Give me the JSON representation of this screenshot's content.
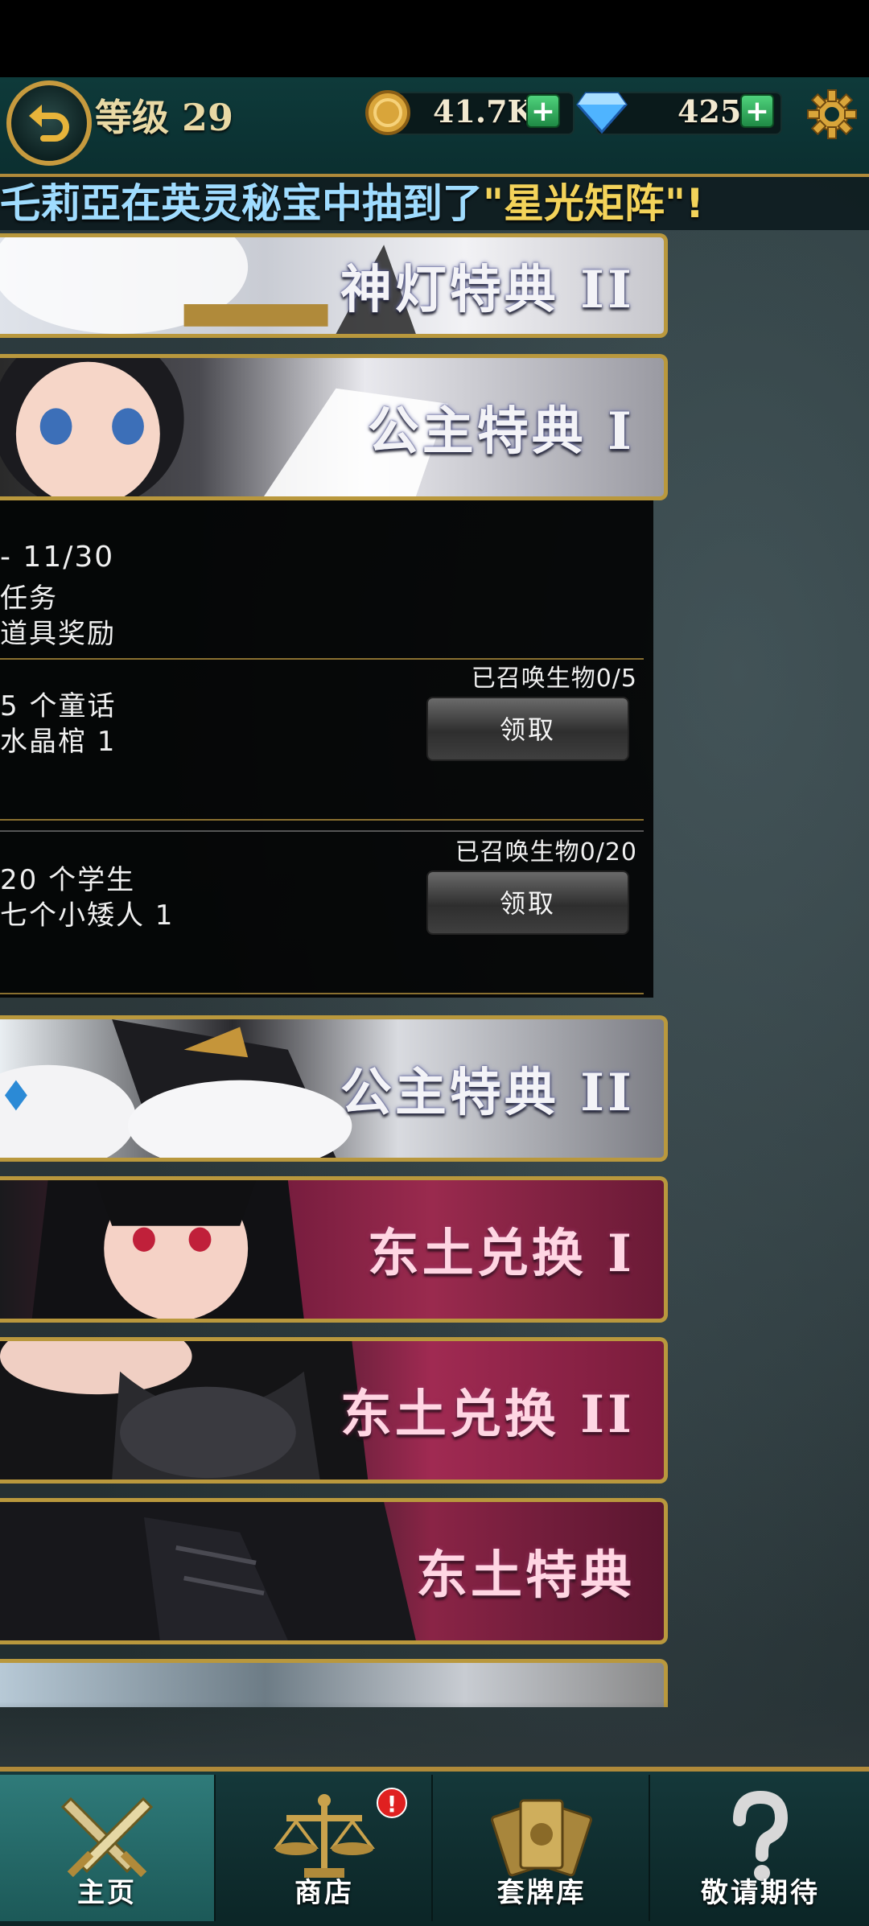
{
  "header": {
    "level_label": "等级 29",
    "gold_value": "41.7K",
    "gem_value": "425",
    "plus_symbol": "+"
  },
  "ticker": {
    "prefix": "乇莉亞在英灵秘宝中抽到了",
    "highlight": "\"星光矩阵\"!"
  },
  "banners": [
    {
      "title": "神灯特典 II"
    },
    {
      "title": "公主特典 I"
    },
    {
      "title": "公主特典 II"
    },
    {
      "title": "东土兑换 I"
    },
    {
      "title": "东土兑换 II"
    },
    {
      "title": "东土特典"
    }
  ],
  "panel": {
    "date": "- 11/30",
    "line1": "任务",
    "line2": "道具奖励",
    "quests": [
      {
        "desc1": "5 个童话",
        "desc2": "水晶棺 1",
        "progress": "已召唤生物0/5",
        "button": "领取"
      },
      {
        "desc1": "20 个学生",
        "desc2": "七个小矮人 1",
        "progress": "已召唤生物0/20",
        "button": "领取"
      }
    ]
  },
  "tabs": [
    {
      "label": "主页",
      "icon": "crossed-swords-icon"
    },
    {
      "label": "商店",
      "icon": "scales-icon"
    },
    {
      "label": "套牌库",
      "icon": "card-deck-icon"
    },
    {
      "label": "敬请期待",
      "icon": "question-mark-icon"
    }
  ],
  "shop_alert": "!",
  "colors": {
    "accent_gold": "#b08a3a",
    "header_teal": "#0e3a3a",
    "active_tab": "#2f7b7a"
  }
}
